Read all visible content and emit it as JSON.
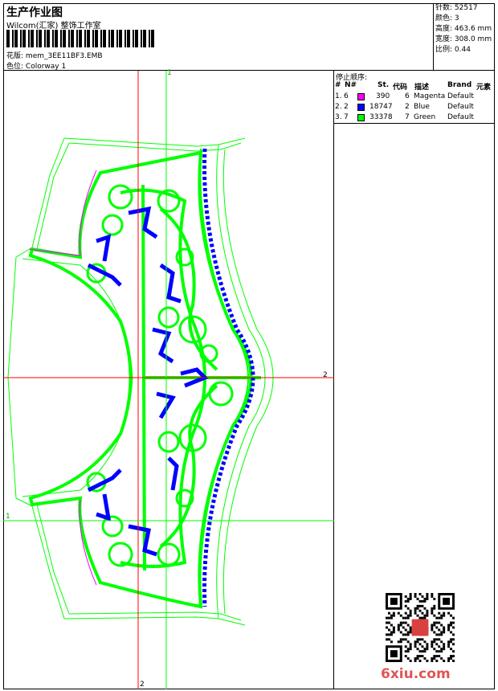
{
  "header": {
    "title": "生产作业图",
    "company": "Wilcom(汇家) 整饰工作室",
    "filename_label": "花版:",
    "filename": "mem_3EE11BF3.EMB",
    "colorway_label": "色位:",
    "colorway": "Colorway 1"
  },
  "stats": {
    "stitches_label": "针数:",
    "stitches": "52517",
    "colors_label": "颜色:",
    "colors": "3",
    "height_label": "高度:",
    "height": "463.6 mm",
    "width_label": "宽度:",
    "width": "308.0 mm",
    "scale_label": "比例:",
    "scale": "0.44"
  },
  "stop_sequence": {
    "title": "停止顺序:",
    "headers": {
      "num": "#",
      "n": "N#",
      "st": "St.",
      "code": "代码",
      "desc": "描述",
      "brand": "Brand",
      "element": "元素"
    },
    "rows": [
      {
        "num": "1.",
        "n": "6",
        "color": "#ff00ff",
        "st": "390",
        "code": "6",
        "desc": "Magenta",
        "brand": "Default"
      },
      {
        "num": "2.",
        "n": "2",
        "color": "#0000ff",
        "st": "18747",
        "code": "2",
        "desc": "Blue",
        "brand": "Default"
      },
      {
        "num": "3.",
        "n": "7",
        "color": "#00ff00",
        "st": "33378",
        "code": "7",
        "desc": "Green",
        "brand": "Default"
      }
    ]
  },
  "markers": {
    "v1": "1",
    "v2": "2",
    "h2": "2",
    "h1": "1"
  },
  "watermark": "6xiu.com",
  "colors": {
    "magenta": "#ff00ff",
    "blue": "#0000ff",
    "green": "#00ff00",
    "guide_red": "#ff0000"
  }
}
